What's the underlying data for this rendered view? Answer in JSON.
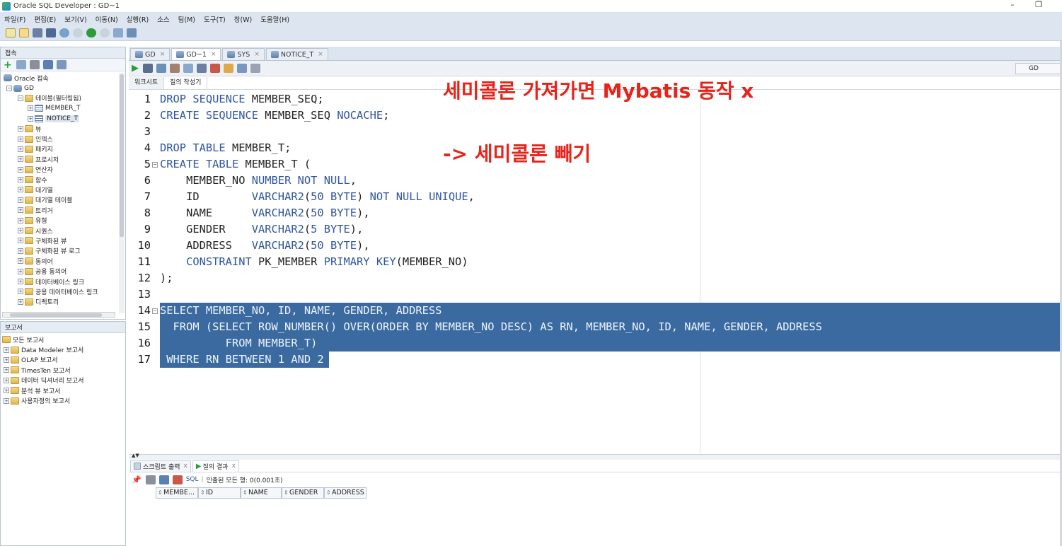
{
  "window": {
    "title": "Oracle SQL Developer : GD~1"
  },
  "menu": [
    "파일(F)",
    "편집(E)",
    "보기(V)",
    "이동(N)",
    "실행(R)",
    "소스",
    "팀(M)",
    "도구(T)",
    "창(W)",
    "도움말(H)"
  ],
  "connections": {
    "title": "접속",
    "tree": [
      {
        "label": "Oracle 접속",
        "icon": "db"
      },
      {
        "label": "GD",
        "icon": "db"
      },
      {
        "label": "테이블(필터링됨)",
        "icon": "folder"
      },
      {
        "label": "MEMBER_T",
        "icon": "table"
      },
      {
        "label": "NOTICE_T",
        "icon": "table"
      },
      {
        "label": "뷰",
        "icon": "folder"
      },
      {
        "label": "인덱스",
        "icon": "folder"
      },
      {
        "label": "패키지",
        "icon": "folder"
      },
      {
        "label": "프로시저",
        "icon": "folder"
      },
      {
        "label": "연산자",
        "icon": "folder"
      },
      {
        "label": "함수",
        "icon": "folder"
      },
      {
        "label": "대기열",
        "icon": "folder"
      },
      {
        "label": "대기열 테이블",
        "icon": "folder"
      },
      {
        "label": "트리거",
        "icon": "folder"
      },
      {
        "label": "유형",
        "icon": "folder"
      },
      {
        "label": "시퀀스",
        "icon": "folder"
      },
      {
        "label": "구체화된 뷰",
        "icon": "folder"
      },
      {
        "label": "구체화된 뷰 로그",
        "icon": "folder"
      },
      {
        "label": "동의어",
        "icon": "folder"
      },
      {
        "label": "공용 동의어",
        "icon": "folder"
      },
      {
        "label": "데이터베이스 링크",
        "icon": "folder"
      },
      {
        "label": "공용 데이터베이스 링크",
        "icon": "folder"
      },
      {
        "label": "디렉토리",
        "icon": "folder"
      }
    ]
  },
  "reports": {
    "title": "보고서",
    "items": [
      "모든 보고서",
      "Data Modeler 보고서",
      "OLAP 보고서",
      "TimesTen 보고서",
      "데이터 딕셔너리 보고서",
      "분석 뷰 보고서",
      "사용자정의 보고서"
    ]
  },
  "editor_tabs": [
    {
      "label": "GD",
      "active": false
    },
    {
      "label": "GD~1",
      "active": true
    },
    {
      "label": "SYS",
      "active": false
    },
    {
      "label": "NOTICE_T",
      "active": false
    }
  ],
  "connection_selector": "GD",
  "worksheet_tabs": [
    "워크시트",
    "질의 작성기"
  ],
  "code_lines": [
    "DROP SEQUENCE MEMBER_SEQ;",
    "CREATE SEQUENCE MEMBER_SEQ NOCACHE;",
    "",
    "DROP TABLE MEMBER_T;",
    "CREATE TABLE MEMBER_T (",
    "    MEMBER_NO NUMBER NOT NULL,",
    "    ID        VARCHAR2(50 BYTE) NOT NULL UNIQUE,",
    "    NAME      VARCHAR2(50 BYTE),",
    "    GENDER    VARCHAR2(5 BYTE),",
    "    ADDRESS   VARCHAR2(50 BYTE),",
    "    CONSTRAINT PK_MEMBER PRIMARY KEY(MEMBER_NO)",
    ");",
    "",
    "SELECT MEMBER_NO, ID, NAME, GENDER, ADDRESS",
    "  FROM (SELECT ROW_NUMBER() OVER(ORDER BY MEMBER_NO DESC) AS RN, MEMBER_NO, ID, NAME, GENDER, ADDRESS",
    "          FROM MEMBER_T)",
    " WHERE RN BETWEEN 1 AND 2"
  ],
  "selected_lines": [
    14,
    15,
    16,
    17
  ],
  "annotations": {
    "note1": "세미콜론 가져가면 Mybatis 동작 x",
    "note2": "-> 세미콜론 빼기"
  },
  "output_tabs": [
    "스크립트 출력",
    "질의 결과"
  ],
  "output_toolbar": {
    "sql_label": "SQL",
    "status": "인출된 모든 행: 0(0.001초)"
  },
  "result_columns": [
    "MEMBE...",
    "ID",
    "NAME",
    "GENDER",
    "ADDRESS"
  ],
  "colors": {
    "selection": "#3a6aa0",
    "keyword": "#2f55a4",
    "annotation": "#e8231a",
    "chrome": "#dde6f0"
  }
}
